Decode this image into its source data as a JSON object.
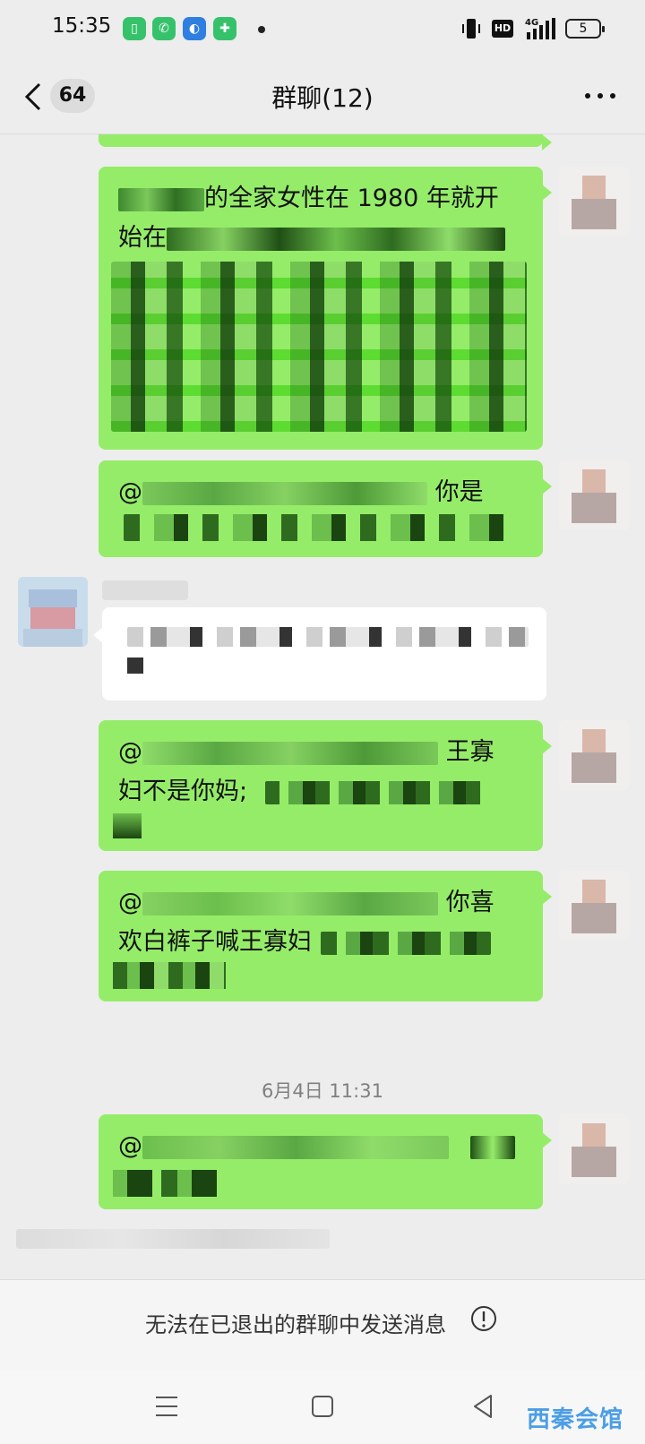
{
  "status_bar": {
    "time": "15:35",
    "hd_label": "HD",
    "network_label": "4G",
    "battery_level": "5"
  },
  "header": {
    "unread_count": "64",
    "title": "群聊(12)"
  },
  "messages": [
    {
      "side": "right",
      "visible_text_1": "的全家女性在 1980 年就开",
      "visible_text_2": "始在"
    },
    {
      "side": "right",
      "visible_text_1": "@",
      "visible_text_2": "你是"
    },
    {
      "side": "left"
    },
    {
      "side": "right",
      "visible_text_1": "@",
      "visible_text_2": "王寡",
      "visible_text_3": "妇不是你妈;"
    },
    {
      "side": "right",
      "visible_text_1": "@",
      "visible_text_2": "你喜",
      "visible_text_3": "欢白裤子喊王寡妇"
    },
    {
      "side": "right",
      "visible_text_1": "@"
    }
  ],
  "timestamp": "6月4日 11:31",
  "notice": {
    "text": "无法在已退出的群聊中发送消息"
  },
  "watermark": "西秦会馆",
  "colors": {
    "bubble_green": "#95ec69",
    "background": "#ededed",
    "watermark": "#4b9ee5"
  },
  "icons": [
    "back-icon",
    "more-icon",
    "info-icon",
    "menu-icon",
    "home-icon",
    "back-triangle-icon"
  ]
}
